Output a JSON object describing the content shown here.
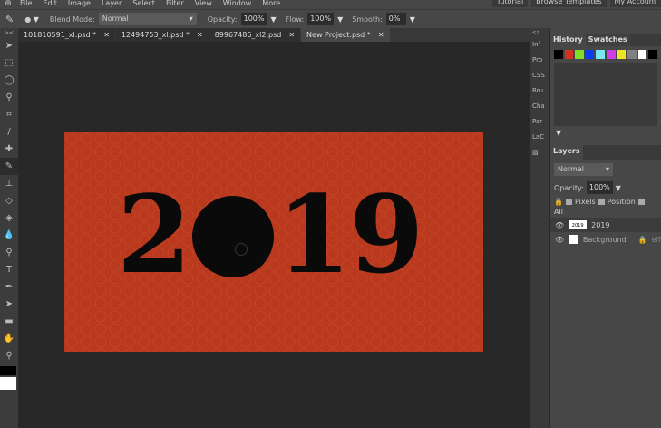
{
  "menu": {
    "items": [
      "File",
      "Edit",
      "Image",
      "Layer",
      "Select",
      "Filter",
      "View",
      "Window",
      "More"
    ],
    "right": [
      "Tutorial",
      "Browse Templates",
      "My Account"
    ]
  },
  "options": {
    "blend_label": "Blend Mode:",
    "blend_value": "Normal",
    "opacity_label": "Opacity:",
    "opacity_value": "100%",
    "flow_label": "Flow:",
    "flow_value": "100%",
    "smooth_label": "Smooth:",
    "smooth_value": "0%"
  },
  "tabs": [
    {
      "label": "101810591_xl.psd *"
    },
    {
      "label": "12494753_xl.psd *"
    },
    {
      "label": "89967486_xl2.psd"
    },
    {
      "label": "New Project.psd *"
    }
  ],
  "canvas": {
    "digit1": "2",
    "digit3": "1",
    "digit4": "9"
  },
  "minipanels": [
    "Inf",
    "Pro",
    "CSS",
    "Bru",
    "Cha",
    "Par",
    "LaC"
  ],
  "history_tabs": [
    "History",
    "Swatches"
  ],
  "swatches": [
    "#000000",
    "#d2321e",
    "#7fe02a",
    "#0a3cf0",
    "#78e6f0",
    "#d23ce6",
    "#f0e628",
    "#808080",
    "#ffffff",
    "#000000"
  ],
  "layers": {
    "tab": "Layers",
    "blend": "Normal",
    "opacity_label": "Opacity:",
    "opacity_value": "100%",
    "lock_pixels": "Pixels",
    "lock_position": "Position",
    "lock_all": "All",
    "items": [
      {
        "name": "2019",
        "thumb": "2019"
      },
      {
        "name": "Background",
        "extra": "eff"
      }
    ]
  }
}
